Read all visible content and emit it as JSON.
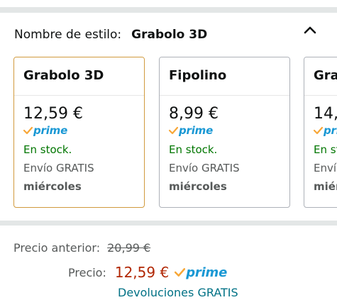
{
  "style": {
    "label": "Nombre de estilo:",
    "selected": "Grabolo 3D"
  },
  "options": [
    {
      "name": "Grabolo 3D",
      "price": "12,59 €",
      "prime": "prime",
      "stock": "En stock.",
      "shipping": "Envío GRATIS",
      "day": "miércoles",
      "selected": true
    },
    {
      "name": "Fipolino",
      "price": "8,99 €",
      "prime": "prime",
      "stock": "En stock.",
      "shipping": "Envío GRATIS",
      "day": "miércoles",
      "selected": false
    },
    {
      "name": "Gra",
      "price": "14,",
      "prime": "pri",
      "stock": "En st",
      "shipping": "Enví",
      "day": "miérc",
      "selected": false
    }
  ],
  "pricing": {
    "previous_label": "Precio anterior:",
    "previous_value": "20,99 €",
    "current_label": "Precio:",
    "current_value": "12,59 €",
    "prime": "prime",
    "returns": "Devoluciones GRATIS"
  },
  "colors": {
    "selected_border": "#d19a3d",
    "stock_green": "#007600",
    "price_red": "#b12704",
    "prime_blue": "#1a98d4",
    "link_teal": "#007185"
  },
  "icons": {
    "collapse": "chevron-up-icon",
    "prime_check": "prime-check-icon"
  }
}
